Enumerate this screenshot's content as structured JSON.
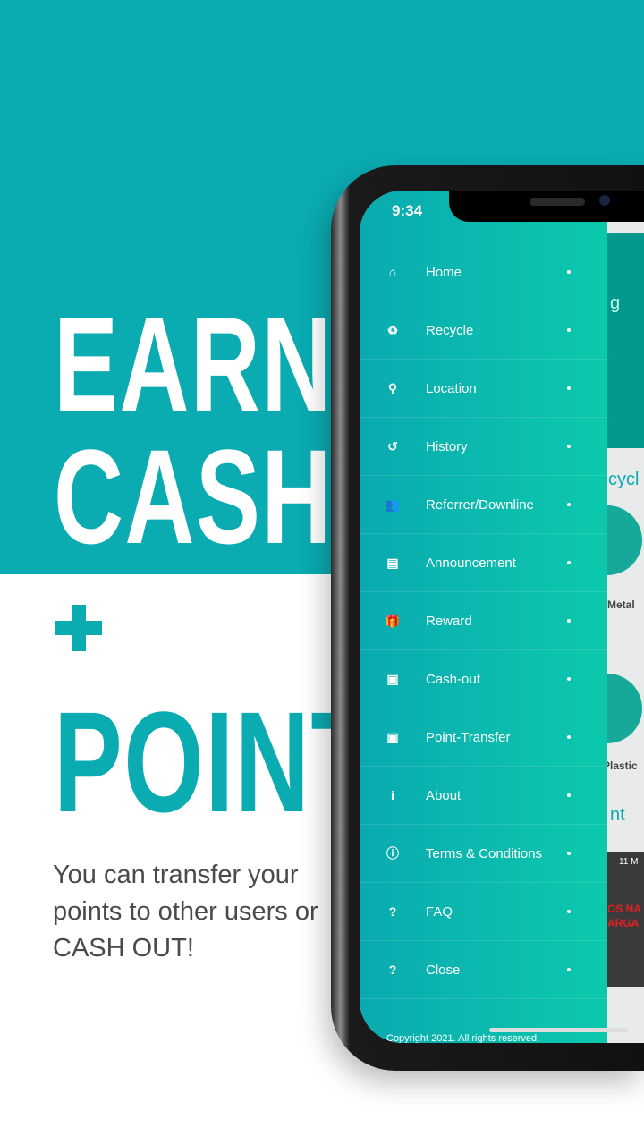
{
  "promo": {
    "line1": "EARN",
    "line2": "CASH",
    "plus": "+",
    "line3": "POINT",
    "subtitle": "You can transfer your points to other users or CASH OUT!"
  },
  "status": {
    "time": "9:34"
  },
  "menu": [
    {
      "label": "Home",
      "icon": "home-icon"
    },
    {
      "label": "Recycle",
      "icon": "recycle-icon"
    },
    {
      "label": "Location",
      "icon": "map-marker-icon"
    },
    {
      "label": "History",
      "icon": "history-icon"
    },
    {
      "label": "Referrer/Downline",
      "icon": "users-icon"
    },
    {
      "label": "Announcement",
      "icon": "clipboard-icon"
    },
    {
      "label": "Reward",
      "icon": "gift-icon"
    },
    {
      "label": "Cash-out",
      "icon": "money-icon"
    },
    {
      "label": "Point-Transfer",
      "icon": "money-icon"
    },
    {
      "label": "About",
      "icon": "info-icon"
    },
    {
      "label": "Terms & Conditions",
      "icon": "info-circle-icon"
    },
    {
      "label": "FAQ",
      "icon": "question-circle-icon"
    },
    {
      "label": "Close",
      "icon": "question-circle-icon"
    }
  ],
  "footer": "Copyright 2021. All rights reserved.",
  "background_app": {
    "frag1": "g",
    "frag2": "cycl",
    "metal": "Metal",
    "plastic": "Plastic",
    "frag3": "nt",
    "date": "11 M",
    "ad": "OS NA\nARGA"
  },
  "colors": {
    "teal": "#0aabb1",
    "drawer_end": "#0cc9ad"
  }
}
